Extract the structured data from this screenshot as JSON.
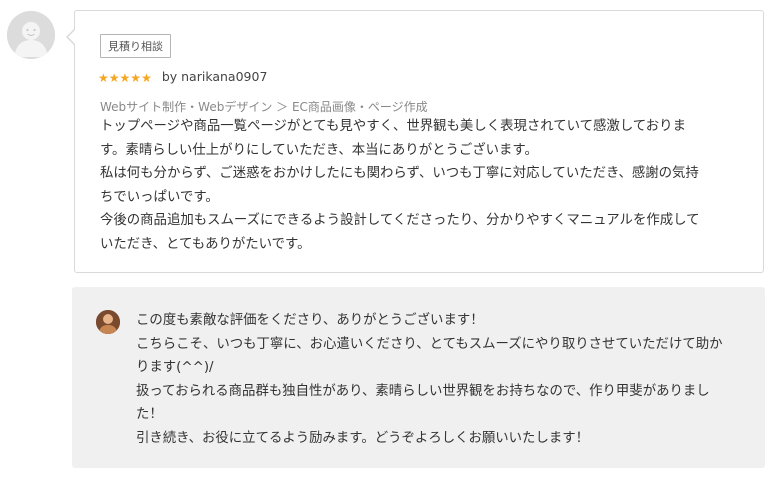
{
  "review": {
    "badge": "見積り相談",
    "rating_stars": 5,
    "byline": "by narikana0907",
    "category": "Webサイト制作・Webデザイン ＞ EC商品画像・ページ作成",
    "lines": [
      "トップページや商品一覧ページがとても見やすく、世界観も美しく表現されていて感激しておりま",
      "す。素晴らしい仕上がりにしていただき、本当にありがとうございます。",
      "私は何も分からず、ご迷惑をおかけしたにも関わらず、いつも丁寧に対応していただき、感謝の気持",
      "ちでいっぱいです。",
      "今後の商品追加もスムーズにできるよう設計してくださったり、分かりやすくマニュアルを作成して",
      "いただき、とてもありがたいです。"
    ]
  },
  "reply": {
    "lines": [
      "この度も素敵な評価をくださり、ありがとうございます！",
      "こちらこそ、いつも丁寧に、お心遣いくださり、とてもスムーズにやり取りさせていただけて助か",
      "ります(^^)/",
      "扱っておられる商品群も独自性があり、素晴らしい世界観をお持ちなので、作り甲斐がありまし",
      "た！",
      "引き続き、お役に立てるよう励みます。どうぞよろしくお願いいたします！"
    ]
  },
  "colors": {
    "star": "#f5a623",
    "reply_background": "#f0f0f0",
    "card_border": "#d9d9d9"
  },
  "icons": {
    "reviewer_avatar": "default-user-avatar-icon",
    "seller_avatar": "seller-profile-photo"
  }
}
